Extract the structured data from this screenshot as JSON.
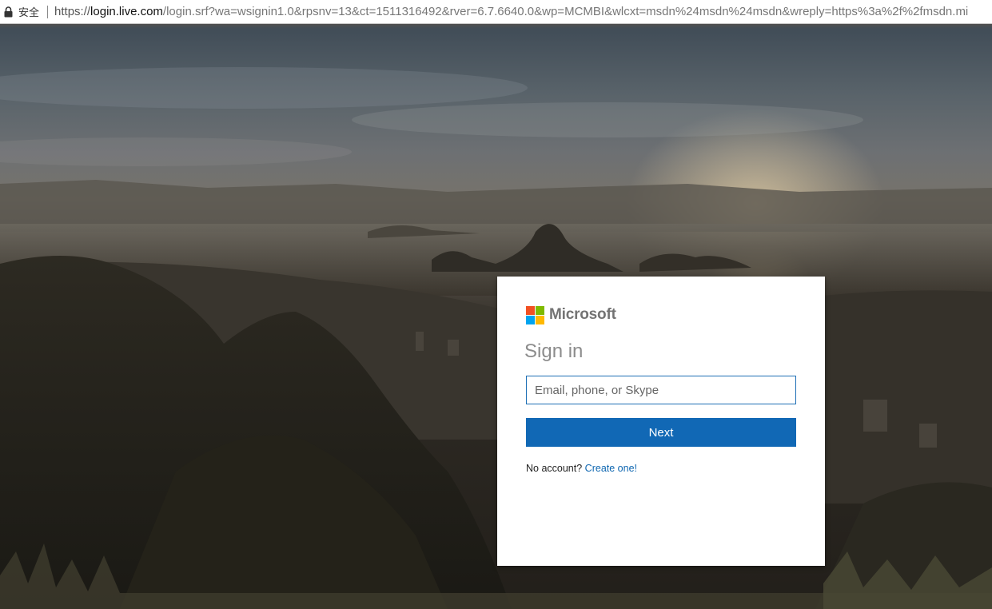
{
  "browser": {
    "secure_label": "安全",
    "url_scheme": "https://",
    "url_host": "login.live.com",
    "url_rest": "/login.srf?wa=wsignin1.0&rpsnv=13&ct=1511316492&rver=6.7.6640.0&wp=MCMBI&wlcxt=msdn%24msdn%24msdn&wreply=https%3a%2f%2fmsdn.mi",
    "lock_icon": "lock-icon"
  },
  "signin": {
    "brand_name": "Microsoft",
    "title": "Sign in",
    "email_placeholder": "Email, phone, or Skype",
    "email_value": "",
    "next_label": "Next",
    "no_account_text": "No account?",
    "create_link_label": "Create one!"
  },
  "colors": {
    "accent": "#1168b5",
    "link": "#0f67b1",
    "logo_red": "#f25022",
    "logo_green": "#7fba00",
    "logo_blue": "#00a4ef",
    "logo_yellow": "#ffb900"
  }
}
